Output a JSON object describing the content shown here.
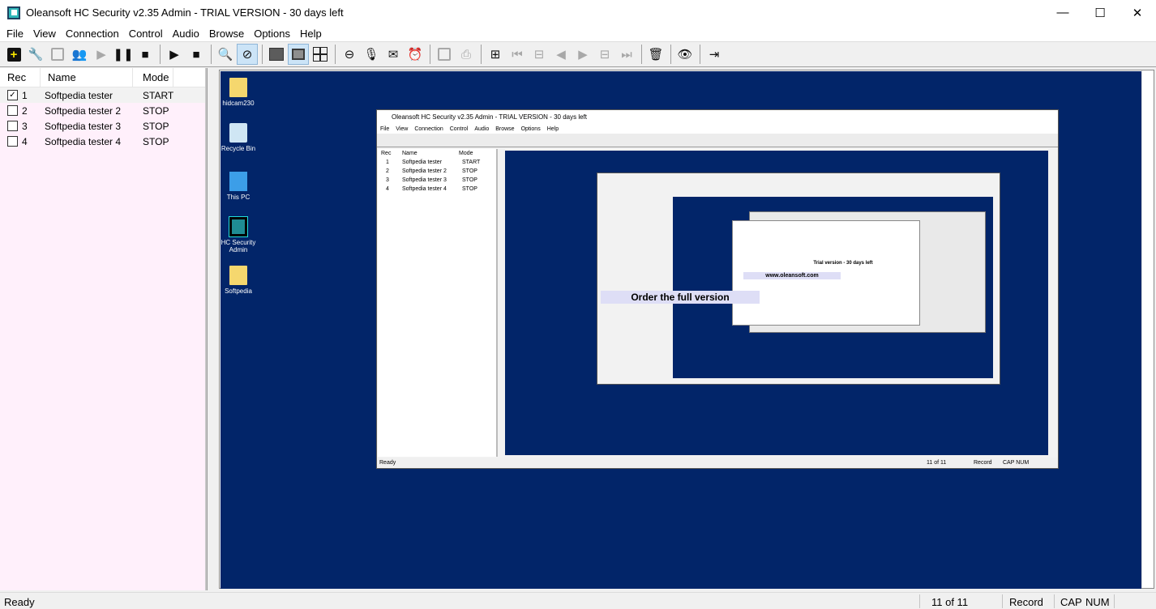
{
  "window": {
    "title": "Oleansoft HC Security v2.35 Admin - TRIAL VERSION - 30 days left",
    "minimize": "—",
    "maximize": "☐",
    "close": "✕"
  },
  "menu": [
    "File",
    "View",
    "Connection",
    "Control",
    "Audio",
    "Browse",
    "Options",
    "Help"
  ],
  "toolbar_icons": [
    "add-icon",
    "wrench-icon",
    "remove-icon",
    "users-icon",
    "play-icon",
    "pause-icon",
    "stop-icon",
    "play-icon",
    "stop-icon",
    "zoom-icon",
    "fit-icon",
    "full-screen-icon",
    "normal-screen-icon",
    "grid-icon",
    "eye-link-icon",
    "microphone-icon",
    "message-icon",
    "alarm-icon",
    "save-icon",
    "print-icon",
    "binoculars-icon",
    "first-icon",
    "prev-frame-icon",
    "prev-icon",
    "next-icon",
    "next-frame-icon",
    "last-icon",
    "delete-icon",
    "view-icon",
    "exit-icon"
  ],
  "list": {
    "headers": {
      "rec": "Rec",
      "name": "Name",
      "mode": "Mode"
    },
    "rows": [
      {
        "num": "1",
        "name": "Softpedia tester",
        "mode": "START",
        "checked": true
      },
      {
        "num": "2",
        "name": "Softpedia tester 2",
        "mode": "STOP",
        "checked": false
      },
      {
        "num": "3",
        "name": "Softpedia tester 3",
        "mode": "STOP",
        "checked": false
      },
      {
        "num": "4",
        "name": "Softpedia tester 4",
        "mode": "STOP",
        "checked": false
      }
    ]
  },
  "desktop": {
    "icons": [
      {
        "label": "hidcam230"
      },
      {
        "label": "Recycle Bin"
      },
      {
        "label": "This PC"
      },
      {
        "label": "HC Security Admin"
      },
      {
        "label": "Softpedia"
      }
    ],
    "nested": {
      "title": "Oleansoft HC Security v2.35 Admin - TRIAL VERSION - 30 days left",
      "status": {
        "text": "Ready",
        "count": "11 of 11",
        "record": "Record",
        "keys": "CAP NUM"
      },
      "banner_order": "Order the full version",
      "banner_url": "www.oleansoft.com",
      "banner_trial": "Trial version - 30 days left"
    }
  },
  "status": {
    "text": "Ready",
    "count": "11 of 11",
    "record": "Record",
    "cap": "CAP",
    "num": "NUM"
  }
}
